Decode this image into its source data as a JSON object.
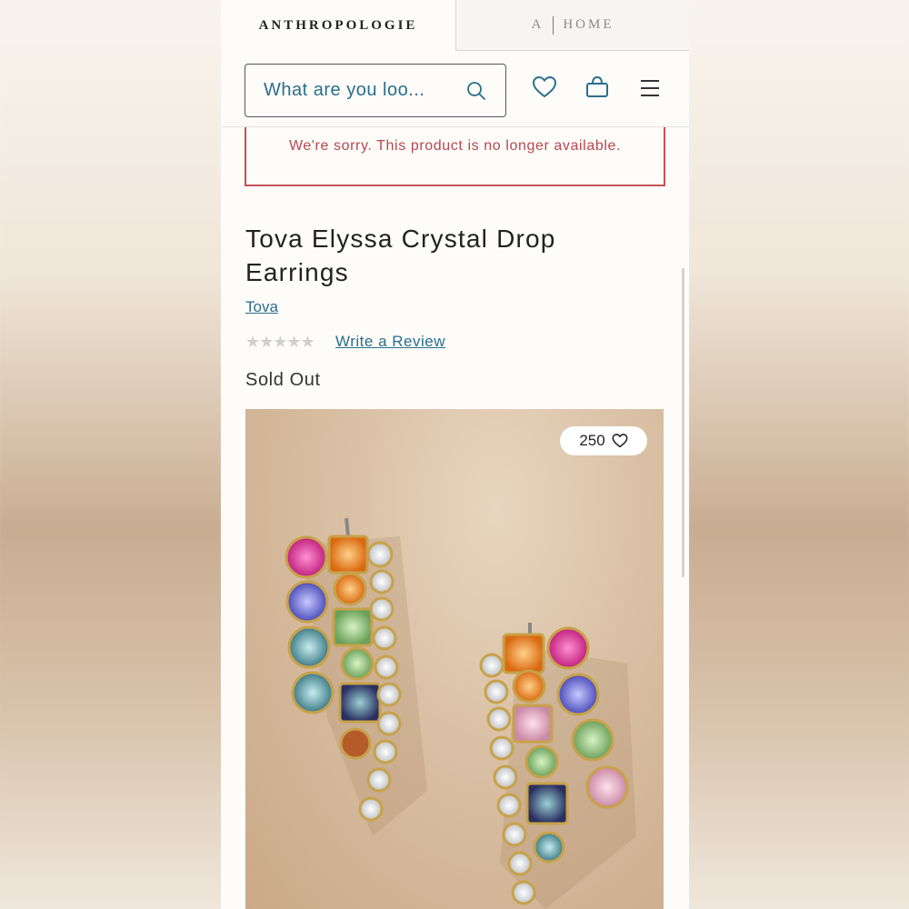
{
  "tabs": {
    "anthropologie": "ANTHROPOLOGIE",
    "home_a": "A",
    "home_label": "HOME"
  },
  "header": {
    "search_placeholder": "What are you loo...",
    "icons": [
      "search-icon",
      "heart-icon",
      "basket-icon",
      "menu-icon"
    ]
  },
  "alert": {
    "message": "We're sorry. This product is no longer available."
  },
  "product": {
    "title": "Tova Elyssa Crystal Drop Earrings",
    "brand": "Tova",
    "rating_stars": "★★★★★",
    "rating": 0,
    "review_link": "Write a Review",
    "status": "Sold Out",
    "favorite_count": "250"
  },
  "colors": {
    "link": "#2b6e8c",
    "alert": "#c4525a",
    "background": "#fdfcf9"
  }
}
